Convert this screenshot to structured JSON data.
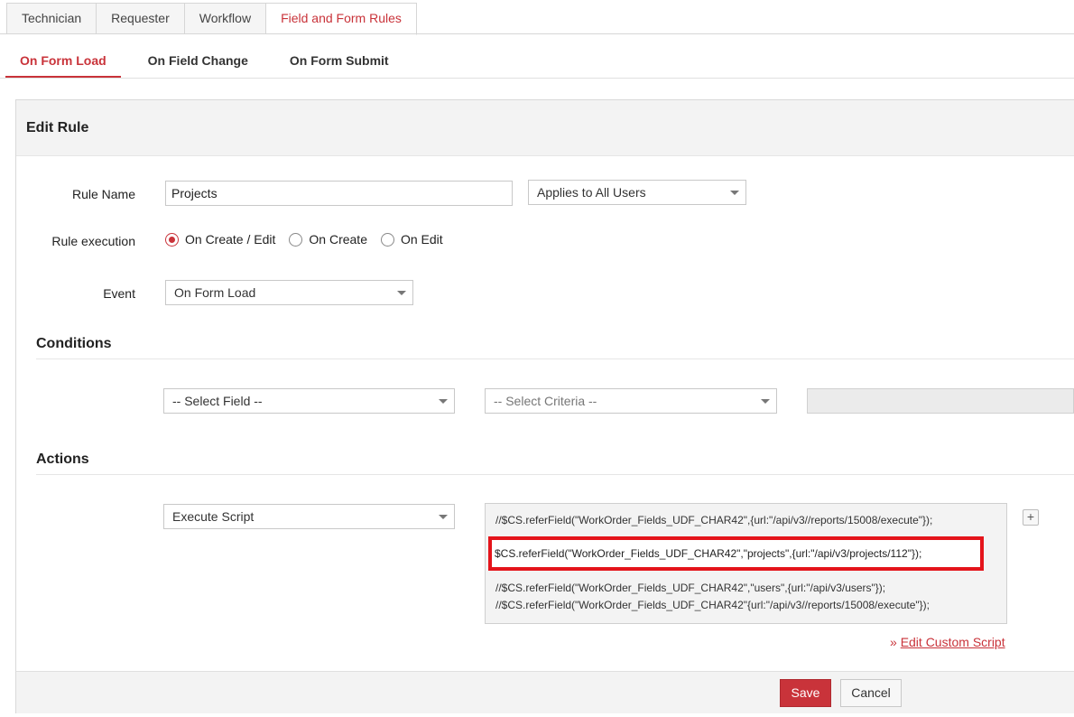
{
  "top_tabs": [
    "Technician",
    "Requester",
    "Workflow",
    "Field and Form Rules"
  ],
  "sub_tabs": [
    "On Form Load",
    "On Field Change",
    "On Form Submit"
  ],
  "panel_title": "Edit Rule",
  "rule_name": {
    "label": "Rule Name",
    "value": "Projects"
  },
  "applies_to": {
    "value": "Applies to All Users"
  },
  "rule_execution": {
    "label": "Rule execution",
    "options": [
      "On Create / Edit",
      "On Create",
      "On Edit"
    ],
    "selected": "On Create / Edit"
  },
  "event": {
    "label": "Event",
    "value": "On Form Load"
  },
  "conditions": {
    "title": "Conditions",
    "field_placeholder": "-- Select Field --",
    "criteria_placeholder": "-- Select Criteria --"
  },
  "actions": {
    "title": "Actions",
    "action_type": "Execute Script",
    "script_lines": [
      "//$CS.referField(\"WorkOrder_Fields_UDF_CHAR42\",{url:\"/api/v3//reports/15008/execute\"});",
      "$CS.referField(\"WorkOrder_Fields_UDF_CHAR42\",\"projects\",{url:\"/api/v3/projects/112\"});",
      "//$CS.referField(\"WorkOrder_Fields_UDF_CHAR42\",\"users\",{url:\"/api/v3/users\"});",
      "//$CS.referField(\"WorkOrder_Fields_UDF_CHAR42\"{url:\"/api/v3//reports/15008/execute\"});"
    ],
    "add_label": "+",
    "edit_prefix": "» ",
    "edit_link": "Edit Custom Script"
  },
  "buttons": {
    "save": "Save",
    "cancel": "Cancel"
  },
  "colors": {
    "accent": "#c9333a",
    "highlight_border": "#e4141b"
  }
}
